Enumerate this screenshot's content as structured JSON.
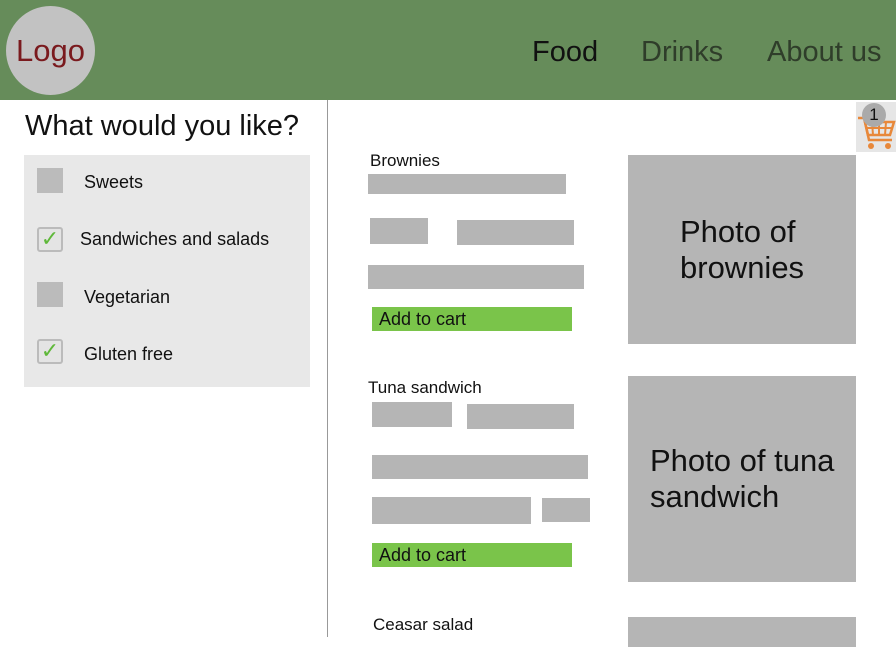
{
  "header": {
    "logo": "Logo",
    "nav": [
      {
        "label": "Food",
        "active": true
      },
      {
        "label": "Drinks",
        "active": false
      },
      {
        "label": "About us",
        "active": false
      }
    ]
  },
  "filters": {
    "title": "What would you like?",
    "options": [
      {
        "label": "Sweets",
        "checked": false
      },
      {
        "label": "Sandwiches and salads",
        "checked": true
      },
      {
        "label": "Vegetarian",
        "checked": false
      },
      {
        "label": "Gluten free",
        "checked": true
      }
    ]
  },
  "cart": {
    "count": "1",
    "icon": "shopping-cart-icon"
  },
  "products": [
    {
      "name": "Brownies",
      "button": "Add to cart",
      "photo": "Photo of brownies"
    },
    {
      "name": "Tuna sandwich",
      "button": "Add to cart",
      "photo": "Photo of tuna sandwich"
    },
    {
      "name": "Ceasar salad"
    }
  ],
  "colors": {
    "header": "#668c5a",
    "button": "#7ac44a",
    "placeholder": "#b5b5b5",
    "logo_text": "#7a1a1e"
  }
}
